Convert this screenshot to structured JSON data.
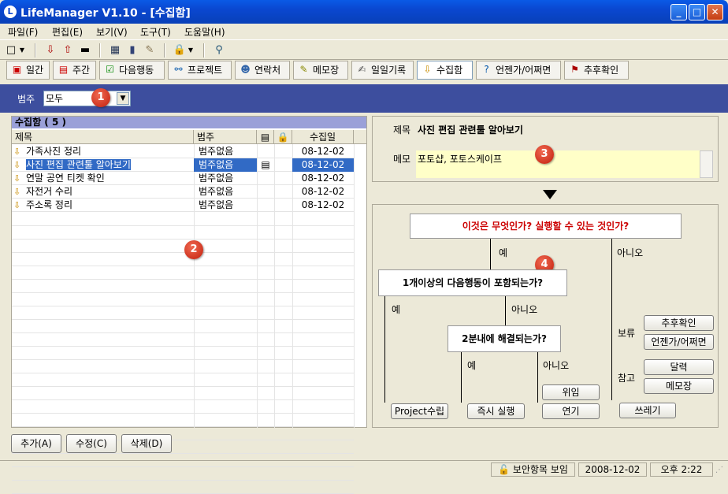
{
  "window": {
    "title": "LifeManager V1.10 - [수집함]"
  },
  "menu": [
    "파일(F)",
    "편집(E)",
    "보기(V)",
    "도구(T)",
    "도움말(H)"
  ],
  "nav_tabs": [
    {
      "label": "일간",
      "icon": "calendar-day-icon"
    },
    {
      "label": "주간",
      "icon": "calendar-week-icon"
    },
    {
      "label": "다음행동",
      "icon": "checklist-icon"
    },
    {
      "label": "프로젝트",
      "icon": "project-tree-icon"
    },
    {
      "label": "연락처",
      "icon": "person-icon"
    },
    {
      "label": "메모장",
      "icon": "notepad-icon"
    },
    {
      "label": "일일기록",
      "icon": "journal-icon"
    },
    {
      "label": "수집함",
      "icon": "inbox-icon"
    },
    {
      "label": "언젠가/어쩌면",
      "icon": "question-icon"
    },
    {
      "label": "추후확인",
      "icon": "followup-icon"
    }
  ],
  "category": {
    "label": "범주",
    "value": "모두"
  },
  "inbox": {
    "header": "수집함 ( 5 )",
    "columns": [
      "제목",
      "범주",
      "",
      "",
      "수집일"
    ],
    "rows": [
      {
        "title": "가족사진 정리",
        "category": "범주없음",
        "memo": "",
        "date": "08-12-02",
        "selected": false
      },
      {
        "title": "사진 편집 관련툴 알아보기",
        "category": "범주없음",
        "memo": "▤",
        "date": "08-12-02",
        "selected": true
      },
      {
        "title": "연말 공연 티켓 확인",
        "category": "범주없음",
        "memo": "",
        "date": "08-12-02",
        "selected": false
      },
      {
        "title": "자전거 수리",
        "category": "범주없음",
        "memo": "",
        "date": "08-12-02",
        "selected": false
      },
      {
        "title": "주소록 정리",
        "category": "범주없음",
        "memo": "",
        "date": "08-12-02",
        "selected": false
      }
    ]
  },
  "detail": {
    "title_label": "제목",
    "title_value": "사진 편집 관련툴 알아보기",
    "memo_label": "메모",
    "memo_value": "포토샵, 포토스케이프"
  },
  "flow": {
    "q1": "이것은 무엇인가? 실행할 수 있는 것인가?",
    "q2": "1개이상의 다음행동이 포함되는가?",
    "q3": "2분내에 해결되는가?",
    "yes": "예",
    "no": "아니오",
    "hold_label": "보류",
    "ref_label": "참고",
    "buttons": {
      "followup": "추후확인",
      "someday": "언젠가/어쩌면",
      "calendar": "달력",
      "memo": "메모장",
      "trash": "쓰레기",
      "project": "Project수립",
      "do_now": "즉시 실행",
      "delegate": "위임",
      "defer": "연기"
    }
  },
  "bottom_buttons": {
    "add": "추가(A)",
    "edit": "수정(C)",
    "delete": "삭제(D)"
  },
  "status": {
    "security": "보안항목 보임",
    "date": "2008-12-02",
    "time": "오후 2:22"
  },
  "badges": [
    "1",
    "2",
    "3",
    "4"
  ]
}
